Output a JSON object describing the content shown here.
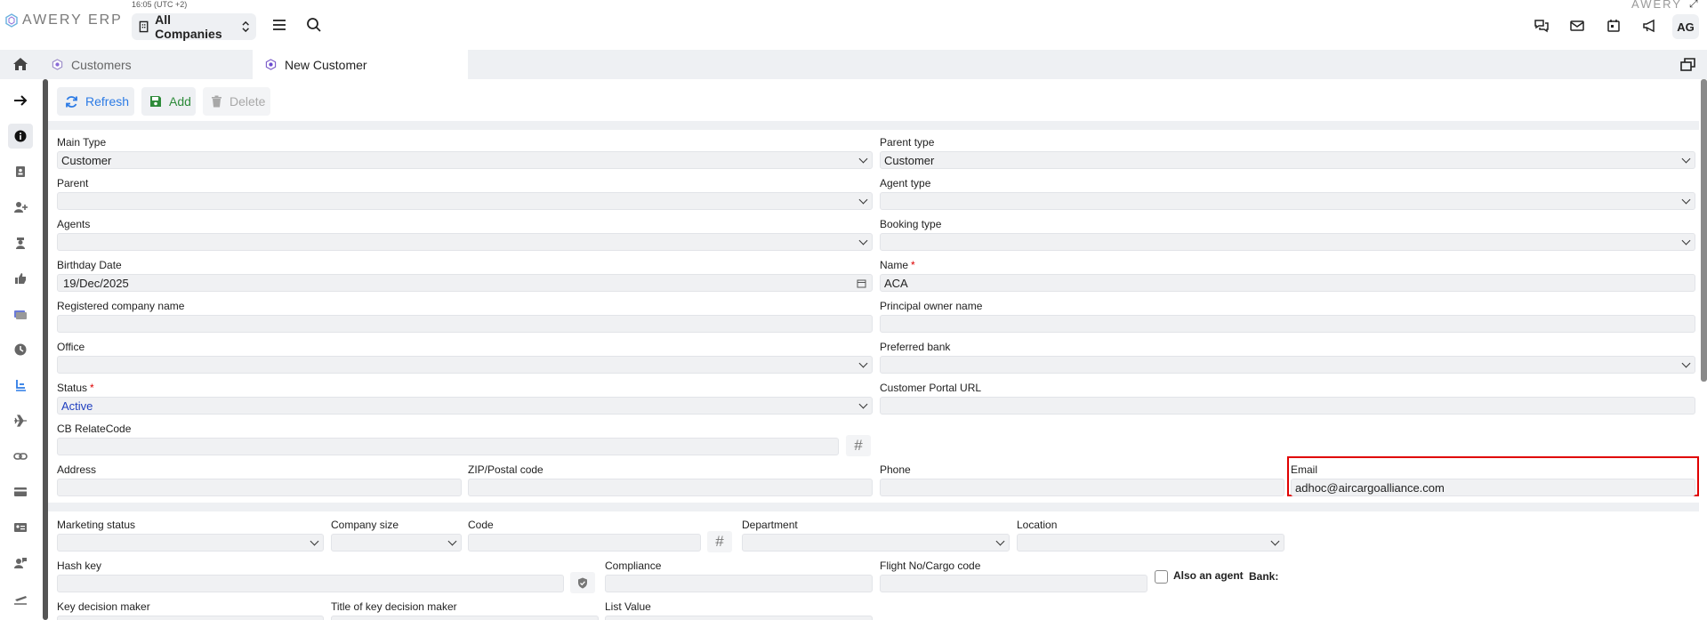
{
  "app": {
    "logo_text": "AWERY ERP",
    "clock": "16:05 (UTC +2)",
    "corner_logo": "AWERY",
    "corner_glyph": "⤢"
  },
  "header": {
    "company_select": "All Companies",
    "user_initials": "AG",
    "icons": [
      "chat-icon",
      "mail-icon",
      "calendar-icon",
      "megaphone-icon"
    ]
  },
  "tabs": [
    {
      "label": "Customers",
      "active": false
    },
    {
      "label": "New Customer",
      "active": true
    }
  ],
  "toolbar": {
    "refresh": "Refresh",
    "add": "Add",
    "delete": "Delete"
  },
  "form": {
    "main_type": {
      "label": "Main Type",
      "value": "Customer"
    },
    "parent_type": {
      "label": "Parent type",
      "value": "Customer"
    },
    "parent": {
      "label": "Parent",
      "value": ""
    },
    "agent_type": {
      "label": "Agent type",
      "value": ""
    },
    "agents": {
      "label": "Agents",
      "value": ""
    },
    "booking_type": {
      "label": "Booking type",
      "value": ""
    },
    "birthday": {
      "label": "Birthday Date",
      "value": "19/Dec/2025"
    },
    "name": {
      "label": "Name",
      "value": "ACA",
      "required": "*"
    },
    "registered_company": {
      "label": "Registered company name",
      "value": ""
    },
    "principal_owner": {
      "label": "Principal owner name",
      "value": ""
    },
    "office": {
      "label": "Office",
      "value": ""
    },
    "preferred_bank": {
      "label": "Preferred bank",
      "value": ""
    },
    "status": {
      "label": "Status",
      "value": "Active",
      "required": "*"
    },
    "portal_url": {
      "label": "Customer Portal URL",
      "value": ""
    },
    "cb_relate": {
      "label": "CB RelateCode",
      "value": "",
      "hash": "#"
    },
    "address": {
      "label": "Address",
      "value": ""
    },
    "zip": {
      "label": "ZIP/Postal code",
      "value": ""
    },
    "phone": {
      "label": "Phone",
      "value": ""
    },
    "email": {
      "label": "Email",
      "value": "adhoc@aircargoalliance.com"
    },
    "marketing_status": {
      "label": "Marketing status",
      "value": ""
    },
    "company_size": {
      "label": "Company size",
      "value": ""
    },
    "code": {
      "label": "Code",
      "value": "",
      "hash": "#"
    },
    "department": {
      "label": "Department",
      "value": ""
    },
    "location": {
      "label": "Location",
      "value": ""
    },
    "hash_key": {
      "label": "Hash key",
      "value": ""
    },
    "compliance": {
      "label": "Compliance",
      "value": ""
    },
    "flight_no": {
      "label": "Flight No/Cargo code",
      "value": ""
    },
    "also_agent": {
      "label": "Also an agent",
      "checked": false
    },
    "bank": {
      "label": "Bank:"
    },
    "key_decision_maker": {
      "label": "Key decision maker",
      "value": ""
    },
    "title_key_decision_maker": {
      "label": "Title of key decision maker",
      "value": ""
    },
    "list_value": {
      "label": "List Value",
      "value": ""
    }
  },
  "colors": {
    "accent_blue": "#2c7be5",
    "add_green": "#2e8b3a",
    "highlight_red": "#e00000",
    "panel_gray": "#eef0f3"
  }
}
